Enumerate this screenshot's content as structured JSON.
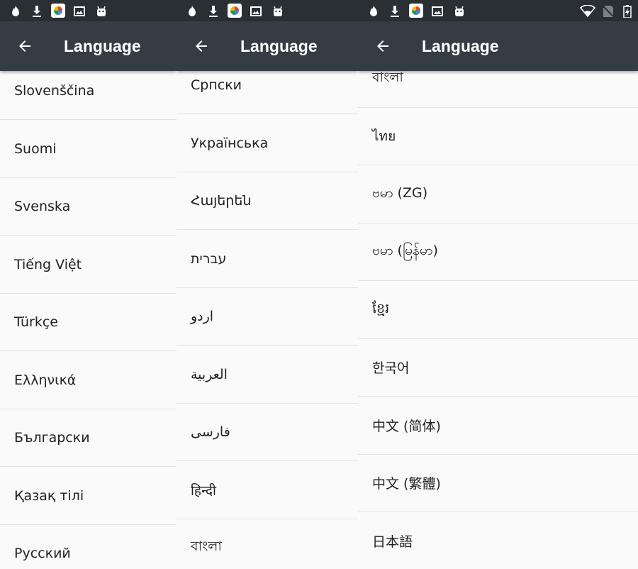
{
  "app": {
    "title": "Language",
    "colors": {
      "status_bar": "#2a2f34",
      "app_bar": "#353c43",
      "background": "#fafafa",
      "divider": "#e3e3e3",
      "text": "#212121"
    }
  },
  "status_icons": [
    "flame-icon",
    "download-icon",
    "app-grid-icon",
    "image-icon",
    "android-icon"
  ],
  "status_icons_right": [
    "wifi-icon",
    "no-sim-icon",
    "battery-icon"
  ],
  "panels": [
    {
      "items": [
        "Slovenščina",
        "Suomi",
        "Svenska",
        "Tiếng Việt",
        "Türkçe",
        "Ελληνικά",
        "Български",
        "Қазақ тілі",
        "Русский"
      ]
    },
    {
      "items": [
        "Српски",
        "Українська",
        "Հայերեն",
        "עברית",
        "اردو",
        "العربية",
        "فارسی",
        "हिन्दी",
        "বাংলা"
      ]
    },
    {
      "items": [
        "বাংলা",
        "ไทย",
        "ဗမာ (ZG)",
        "ဗမာ (မြန်မာ)",
        "ខ្មែរ",
        "한국어",
        "中文 (简体)",
        "中文 (繁體)",
        "日本語"
      ]
    }
  ]
}
